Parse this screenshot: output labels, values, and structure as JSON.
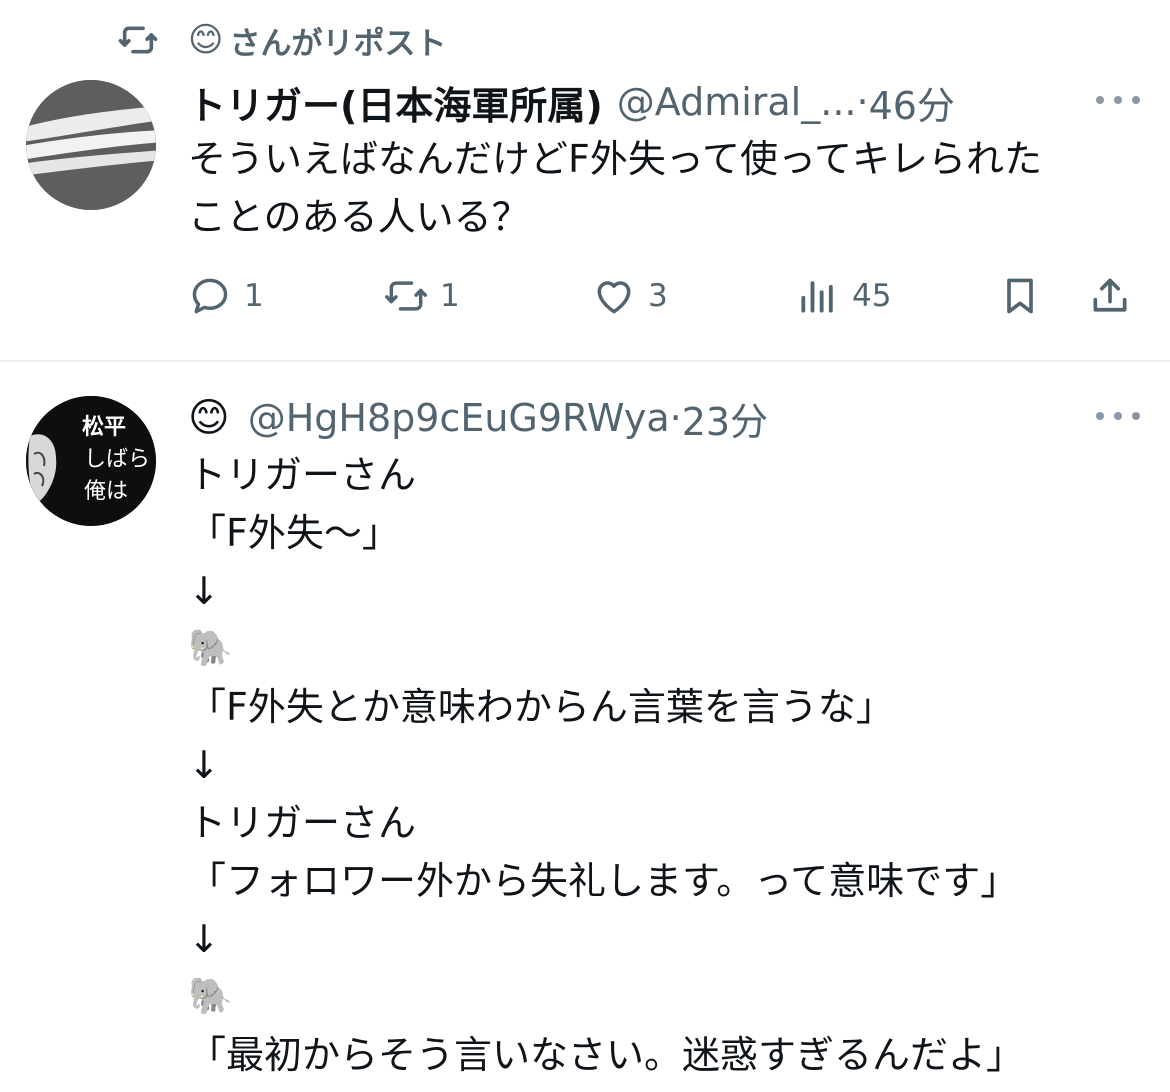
{
  "repost": {
    "icon": "repost-icon",
    "user_emoji": "😊",
    "label": "さんがリポスト"
  },
  "tweet1": {
    "display_name": "トリガー(日本海軍所属)",
    "handle": "@Admiral_...",
    "dot": "·",
    "time": "46分",
    "text": "そういえばなんだけどF外失って使ってキレられた\nことのある人いる？",
    "stats": {
      "replies": "1",
      "reposts": "1",
      "likes": "3",
      "views": "45"
    }
  },
  "tweet2": {
    "display_emoji": "😊",
    "handle": "@HgH8p9cEuG9RWya",
    "dot": "·",
    "time": "23分",
    "avatar_text": [
      "松平",
      "しばら",
      "俺は"
    ],
    "lines": [
      "トリガーさん",
      "「F外失〜」",
      "↓",
      "🐘",
      "「F外失とか意味わからん言葉を言うな」",
      "↓",
      "トリガーさん",
      "「フォロワー外から失礼します。って意味です」",
      "↓",
      "🐘",
      "「最初からそう言いなさい。迷惑すぎるんだよ」"
    ]
  },
  "colors": {
    "text": "#0f1419",
    "secondary": "#536471",
    "divider": "#eff3f4"
  }
}
